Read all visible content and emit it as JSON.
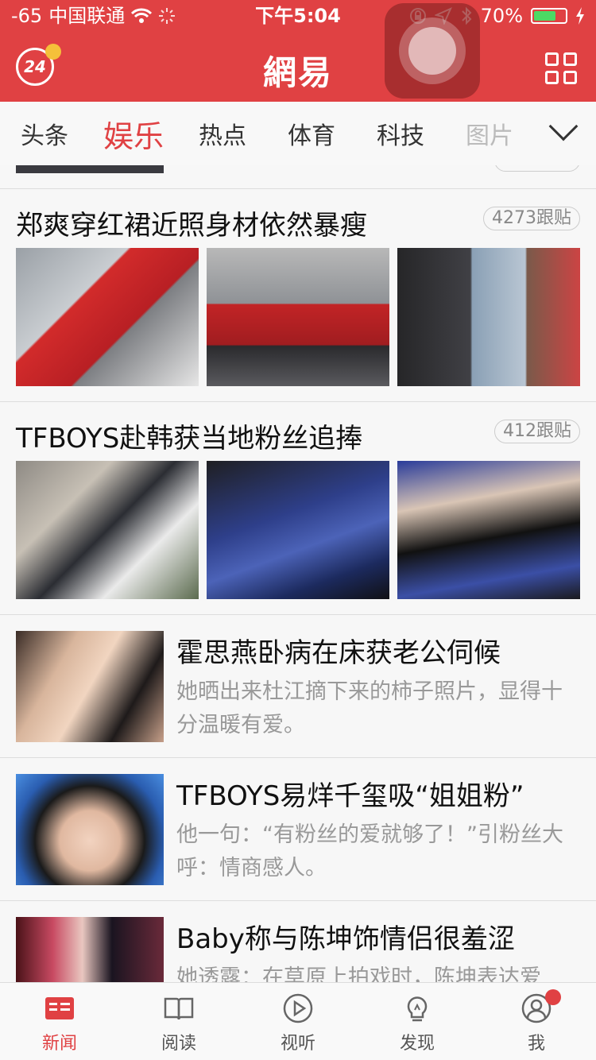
{
  "status_bar": {
    "signal": "-65",
    "carrier": "中国联通",
    "time": "下午5:04",
    "battery": "70%",
    "battery_level": 0.7
  },
  "header": {
    "logo": "網易",
    "badge": "24",
    "icons": [
      "24-hour-news-icon",
      "grid-menu-icon"
    ]
  },
  "channels": {
    "items": [
      "头条",
      "娱乐",
      "热点",
      "体育",
      "科技",
      "图片"
    ],
    "active_index": 1
  },
  "feed": {
    "photo_items": [
      {
        "title": "郑爽穿红裙近照身材依然暴瘦",
        "comments": "4273跟贴"
      },
      {
        "title": "TFBOYS赴韩获当地粉丝追捧",
        "comments": "412跟贴"
      }
    ],
    "text_items": [
      {
        "title": "霍思燕卧病在床获老公伺候",
        "desc": "她晒出来杜江摘下来的柿子照片，显得十分温暖有爱。"
      },
      {
        "title": "TFBOYS易烊千玺吸“姐姐粉”",
        "desc": "他一句：“有粉丝的爱就够了！”引粉丝大呼：情商感人。"
      },
      {
        "title": "Baby称与陈坤饰情侣很羞涩",
        "desc": "她透露：在草原上拍戏时，陈坤表达爱"
      }
    ]
  },
  "tabbar": {
    "items": [
      {
        "label": "新闻",
        "icon": "news-icon"
      },
      {
        "label": "阅读",
        "icon": "book-icon"
      },
      {
        "label": "视听",
        "icon": "play-icon"
      },
      {
        "label": "发现",
        "icon": "lightbulb-icon"
      },
      {
        "label": "我",
        "icon": "user-icon"
      }
    ],
    "active_index": 0
  },
  "colors": {
    "brand": "#e04143",
    "battery": "#4cd964",
    "badge_dot": "#f5c03a"
  }
}
